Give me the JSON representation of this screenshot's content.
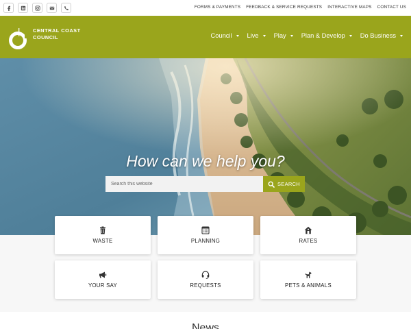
{
  "social": [
    "facebook-icon",
    "linkedin-icon",
    "instagram-icon",
    "email-icon",
    "phone-icon"
  ],
  "utility_links": [
    "FORMS & PAYMENTS",
    "FEEDBACK & SERVICE REQUESTS",
    "INTERACTIVE MAPS",
    "CONTACT US"
  ],
  "logo": {
    "line1": "CENTRAL COAST",
    "line2": "COUNCIL"
  },
  "nav": [
    "Council",
    "Live",
    "Play",
    "Plan & Develop",
    "Do Business"
  ],
  "hero": {
    "title": "How can we help you?",
    "search_placeholder": "Search this website",
    "search_button": "SEARCH"
  },
  "tiles": [
    {
      "label": "WASTE",
      "icon": "trash-icon"
    },
    {
      "label": "PLANNING",
      "icon": "planning-icon"
    },
    {
      "label": "RATES",
      "icon": "house-icon"
    },
    {
      "label": "YOUR SAY",
      "icon": "megaphone-icon"
    },
    {
      "label": "REQUESTS",
      "icon": "headset-icon"
    },
    {
      "label": "PETS & ANIMALS",
      "icon": "dog-icon"
    }
  ],
  "news_heading": "News",
  "colors": {
    "brand": "#9aa51c",
    "topbar": "#ffffff",
    "tile_bg": "#ffffff"
  }
}
